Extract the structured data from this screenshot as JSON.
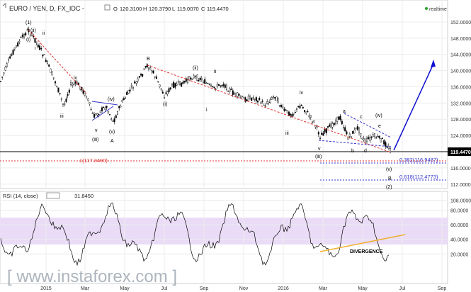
{
  "header": {
    "symbol": "EURO / YEN, D, FX_IDC -",
    "o_label": "O",
    "o_value": "120.3100",
    "h_label": "H",
    "h_value": "120.3790",
    "l_label": "L",
    "l_value": "119.0070",
    "c_label": "C",
    "c_value": "119.4470",
    "realtime": "realtime"
  },
  "watermark": "[ www.instaforex.com ]",
  "price_axis": {
    "ticks": [
      "152.0000",
      "148.0000",
      "144.0000",
      "140.0000",
      "136.0000",
      "132.0000",
      "128.0000",
      "124.0000",
      "120.0000",
      "116.0000",
      "112.0000",
      "108.0000"
    ],
    "current_price": "119.4470"
  },
  "rsi_axis": {
    "ticks": [
      "80.0000",
      "60.0000",
      "40.0000",
      "20.0000"
    ]
  },
  "time_axis": {
    "ticks": [
      "2015",
      "Mar",
      "May",
      "Jul",
      "Sep",
      "Nov",
      "2016",
      "Mar",
      "May",
      "Jul",
      "Sep"
    ]
  },
  "rsi": {
    "label": "RSI (14, close)",
    "value": "31.8450",
    "divergence": "DIVERGENCE"
  },
  "fib": {
    "level_1": "1(117.3490)",
    "level_0382": "0.382(116.9487)",
    "level_0618": "0.618(112.4773)"
  },
  "wave_labels": {
    "w1": "(1)",
    "wii_top": "(ii)",
    "wii_i": "ii",
    "wi_paren": "(i)",
    "wi": "i",
    "iii_left": "iii",
    "iv_left": "iv",
    "v_left": "v",
    "iv_paren_left": "(iv)",
    "iii_paren_left": "(iii)",
    "v_paren_left": "(v)",
    "A": "A",
    "B": "B",
    "i_paren_mid": "(i)",
    "ii_paren_mid": "(ii)",
    "ii_mid": "ii",
    "i_mid": "i",
    "iii_right": "iii",
    "iv_right": "iv",
    "v_right": "v",
    "iii_paren_right": "(iii)",
    "a": "a",
    "b": "b",
    "c": "c",
    "d": "d",
    "e": "e",
    "iv_paren_right": "(iv)",
    "v_paren_right": "(v)",
    "B_right": "B",
    "w2": "(2)"
  },
  "colors": {
    "bull": "#ffffff",
    "bear": "#000000",
    "trend": "#e03030",
    "channel": "#3333cc",
    "target_arrow": "#1010d0",
    "rsi_band": "#eadcf7",
    "rsi_line": "#000000",
    "divergence": "#f0b030",
    "realtime": "#2aa52a"
  }
}
